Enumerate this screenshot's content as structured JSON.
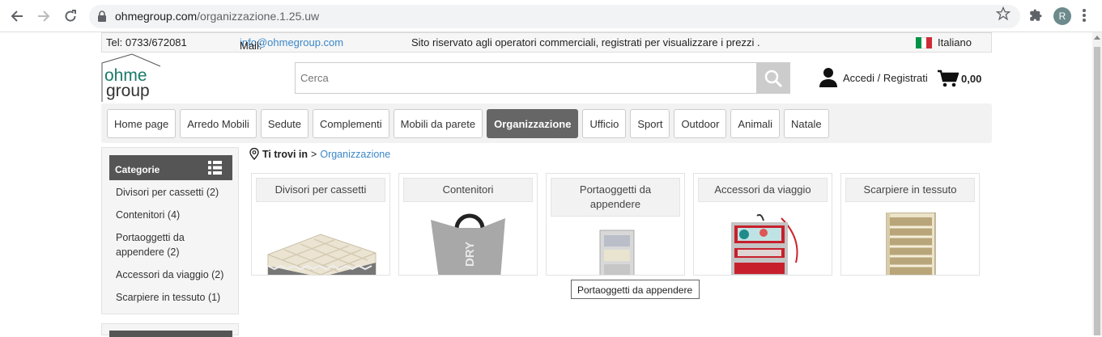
{
  "browser": {
    "url_host": "ohmegroup.com",
    "url_path": "/organizzazione.1.25.uw",
    "profile_initial": "R"
  },
  "topbar": {
    "tel": "Tel: 0733/672081",
    "mail_label": "Mail: ",
    "mail": "info@ohmegroup.com",
    "notice": "Sito riservato agli operatori commerciali, registrati per visualizzare i prezzi .",
    "language": "Italiano"
  },
  "logo": {
    "line1": "ohme",
    "line2": "group"
  },
  "search": {
    "placeholder": "Cerca"
  },
  "account": {
    "label": "Accedi / Registrati"
  },
  "cart": {
    "total": "0,00"
  },
  "nav": {
    "items": [
      "Home page",
      "Arredo Mobili",
      "Sedute",
      "Complementi",
      "Mobili da parete",
      "Organizzazione",
      "Ufficio",
      "Sport",
      "Outdoor",
      "Animali",
      "Natale"
    ],
    "active": "Organizzazione"
  },
  "sidebar": {
    "title": "Categorie",
    "categories": [
      "Divisori per cassetti (2)",
      "Contenitori (4)",
      "Portaoggetti da appendere (2)",
      "Accessori da viaggio (2)",
      "Scarpiere in tessuto (1)"
    ]
  },
  "breadcrumb": {
    "prefix": "Ti trovi in",
    "sep": ">",
    "current": "Organizzazione"
  },
  "products": [
    {
      "title": "Divisori per cassetti"
    },
    {
      "title": "Contenitori"
    },
    {
      "title": "Portaoggetti da appendere"
    },
    {
      "title": "Accessori da viaggio"
    },
    {
      "title": "Scarpiere in tessuto"
    }
  ],
  "tooltip": "Portaoggetti da appendere",
  "colors": {
    "link": "#3b87c7",
    "brand_green": "#1a7a6a",
    "active_nav": "#666666"
  }
}
